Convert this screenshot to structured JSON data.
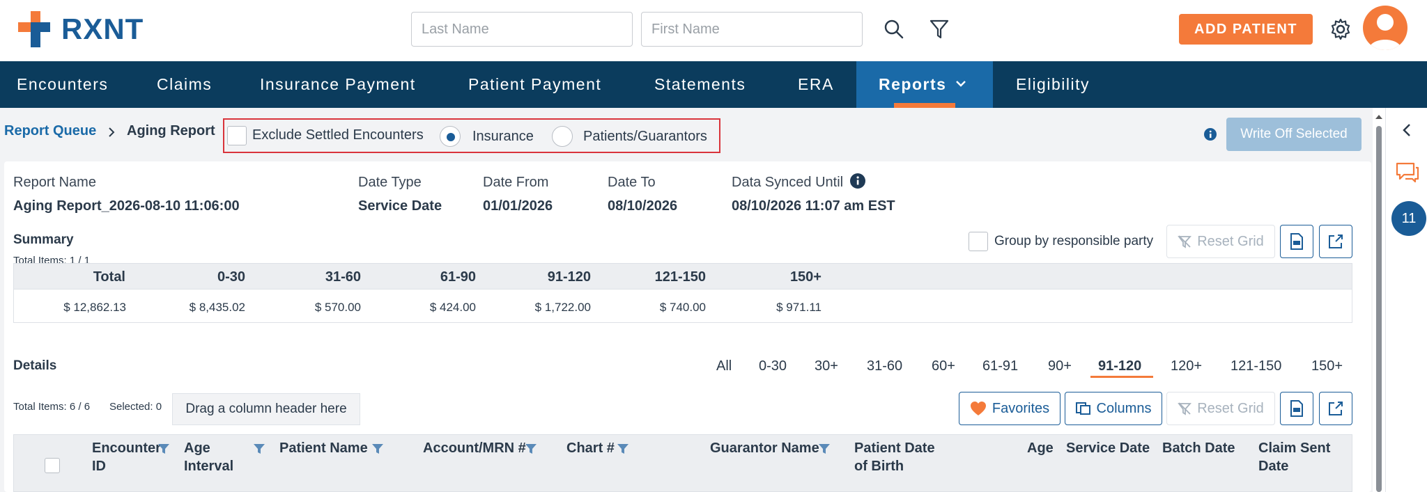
{
  "brand": {
    "name": "RXNT",
    "accent": "#f47a3a",
    "primary": "#0b3c5d"
  },
  "header": {
    "last_name_placeholder": "Last Name",
    "first_name_placeholder": "First Name",
    "add_patient_label": "ADD PATIENT",
    "icons": [
      "search-icon",
      "filter-icon",
      "gear-icon",
      "user-avatar-icon"
    ]
  },
  "nav": {
    "items": [
      {
        "label": "Encounters"
      },
      {
        "label": "Claims"
      },
      {
        "label": "Insurance Payment"
      },
      {
        "label": "Patient Payment"
      },
      {
        "label": "Statements"
      },
      {
        "label": "ERA"
      },
      {
        "label": "Reports"
      },
      {
        "label": "Eligibility"
      }
    ],
    "active": "Reports"
  },
  "toolbar": {
    "breadcrumb_parent": "Report Queue",
    "breadcrumb_current": "Aging Report",
    "exclude_settled_label": "Exclude Settled Encounters",
    "insurance_label": "Insurance",
    "patients_label": "Patients/Guarantors",
    "selected_radio": "Insurance",
    "write_off_label": "Write Off Selected"
  },
  "report": {
    "name_label": "Report Name",
    "name_value": "Aging Report_2026-08-10 11:06:00",
    "date_type_label": "Date Type",
    "date_type_value": "Service Date",
    "date_from_label": "Date From",
    "date_from_value": "01/01/2026",
    "date_to_label": "Date To",
    "date_to_value": "08/10/2026",
    "synced_label": "Data Synced Until",
    "synced_value": "08/10/2026 11:07 am EST"
  },
  "summary": {
    "title": "Summary",
    "total_items": "Total Items: 1 / 1",
    "group_label": "Group by responsible party",
    "reset_label": "Reset Grid",
    "headers": [
      "Total",
      "0-30",
      "31-60",
      "61-90",
      "91-120",
      "121-150",
      "150+"
    ],
    "values": [
      "$ 12,862.13",
      "$ 8,435.02",
      "$ 570.00",
      "$ 424.00",
      "$ 1,722.00",
      "$ 740.00",
      "$ 971.11"
    ]
  },
  "details": {
    "title": "Details",
    "tabs": [
      "All",
      "0-30",
      "30+",
      "31-60",
      "60+",
      "61-91",
      "90+",
      "91-120",
      "120+",
      "121-150",
      "150+"
    ],
    "active_tab": "91-120",
    "total_items": "Total Items: 6 / 6",
    "selected": "Selected: 0",
    "drag_hint": "Drag a column header here",
    "favorites_label": "Favorites",
    "columns_label": "Columns",
    "reset_label": "Reset Grid",
    "columns": [
      {
        "label": "Encounter ID"
      },
      {
        "label": "Age Interval"
      },
      {
        "label": "Patient Name"
      },
      {
        "label": "Account/MRN #"
      },
      {
        "label": "Chart #"
      },
      {
        "label": "Guarantor Name"
      },
      {
        "label": "Patient Date of Birth"
      },
      {
        "label": "Age"
      },
      {
        "label": "Service Date"
      },
      {
        "label": "Batch Date"
      },
      {
        "label": "Claim Sent Date"
      }
    ]
  },
  "right_rail": {
    "badge_count": "11"
  }
}
